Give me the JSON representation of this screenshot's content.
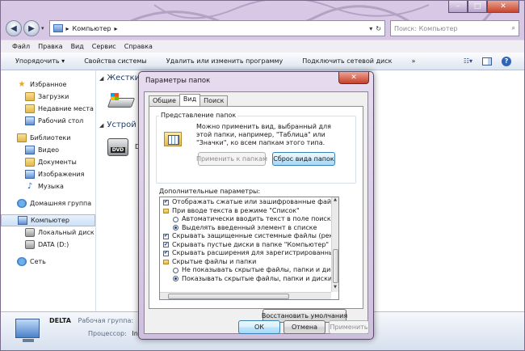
{
  "explorer": {
    "address": "Компьютер",
    "search_placeholder": "Поиск: Компьютер",
    "menu": [
      "Файл",
      "Правка",
      "Вид",
      "Сервис",
      "Справка"
    ],
    "toolbar": [
      "Упорядочить ▾",
      "Свойства системы",
      "Удалить или изменить программу",
      "Подключить сетевой диск",
      "»"
    ],
    "nav": {
      "favorites": "Избранное",
      "fav_items": [
        "Загрузки",
        "Недавние места",
        "Рабочий стол"
      ],
      "libraries": "Библиотеки",
      "lib_items": [
        "Видео",
        "Документы",
        "Изображения",
        "Музыка"
      ],
      "homegroup": "Домашняя группа",
      "computer": "Компьютер",
      "comp_items": [
        "Локальный диск (C",
        "DATA (D:)"
      ],
      "network": "Сеть"
    },
    "content": {
      "hdd_header": "Жестки",
      "devices_header": "Устрой",
      "dvd_label": "D"
    },
    "details": {
      "name": "DELTA",
      "workgroup_label": "Рабочая группа:",
      "workgroup_value": "WO",
      "processor_label": "Процессор:",
      "processor_value": "Inte"
    }
  },
  "dialog": {
    "title": "Параметры папок",
    "tabs": [
      "Общие",
      "Вид",
      "Поиск"
    ],
    "folder_view": {
      "legend": "Представление папок",
      "description": "Можно применить вид, выбранный для этой папки, например, \"Таблица\" или \"Значки\", ко всем папкам этого типа.",
      "apply_button": "Применить к папкам",
      "reset_button": "Сброс вида папок"
    },
    "advanced_label": "Дополнительные параметры:",
    "advanced_items": [
      {
        "kind": "check",
        "checked": true,
        "indent": 0,
        "text": "Отображать сжатые или зашифрованные файлы NTF"
      },
      {
        "kind": "folder",
        "indent": 0,
        "text": "При вводе текста в режиме \"Список\""
      },
      {
        "kind": "radio",
        "checked": false,
        "indent": 1,
        "text": "Автоматически вводить текст в поле поиска"
      },
      {
        "kind": "radio",
        "checked": true,
        "indent": 1,
        "text": "Выделять введенный элемент в списке"
      },
      {
        "kind": "check",
        "checked": true,
        "indent": 0,
        "text": "Скрывать защищенные системные файлы (рекоменд"
      },
      {
        "kind": "check",
        "checked": true,
        "indent": 0,
        "text": "Скрывать пустые диски в папке \"Компьютер\""
      },
      {
        "kind": "check",
        "checked": true,
        "indent": 0,
        "text": "Скрывать расширения для зарегистрированных типо"
      },
      {
        "kind": "folder",
        "indent": 0,
        "text": "Скрытые файлы и папки"
      },
      {
        "kind": "radio",
        "checked": false,
        "indent": 1,
        "text": "Не показывать скрытые файлы, папки и диски"
      },
      {
        "kind": "radio",
        "checked": true,
        "indent": 1,
        "text": "Показывать скрытые файлы, папки и диски"
      }
    ],
    "restore_button": "Восстановить умолчания",
    "ok_button": "ОК",
    "cancel_button": "Отмена",
    "apply_button": "Применить"
  }
}
